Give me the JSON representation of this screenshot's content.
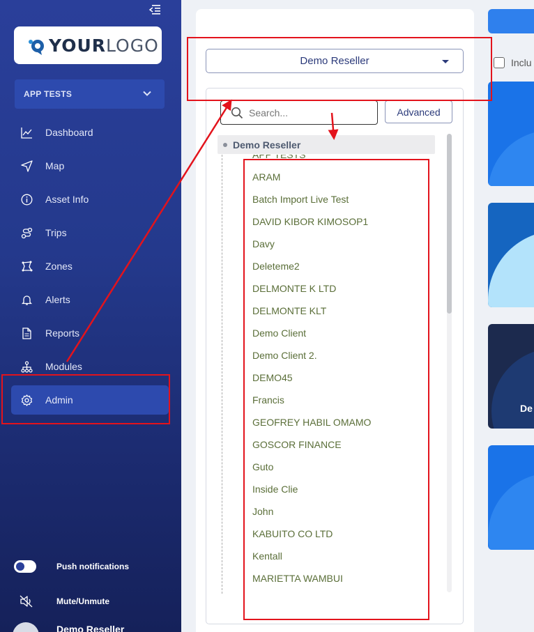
{
  "sidebar": {
    "logo_text_a": "YOUR",
    "logo_text_b": "LOGO",
    "app_selector": "APP TESTS",
    "nav": [
      {
        "label": "Dashboard",
        "icon": "chart-line-icon"
      },
      {
        "label": "Map",
        "icon": "navigation-arrow-icon"
      },
      {
        "label": "Asset Info",
        "icon": "info-circle-icon"
      },
      {
        "label": "Trips",
        "icon": "route-icon"
      },
      {
        "label": "Zones",
        "icon": "polygon-icon"
      },
      {
        "label": "Alerts",
        "icon": "bell-icon"
      },
      {
        "label": "Reports",
        "icon": "file-icon"
      },
      {
        "label": "Modules",
        "icon": "hierarchy-icon"
      },
      {
        "label": "Admin",
        "icon": "gear-icon",
        "active": true
      }
    ],
    "push_notifications": "Push notifications",
    "mute_unmute": "Mute/Unmute",
    "user_name": "Demo Reseller"
  },
  "main": {
    "reseller_dropdown": "Demo Reseller",
    "search_placeholder": "Search...",
    "advanced_button": "Advanced",
    "tree_root": "Demo Reseller",
    "tree_items": [
      "APP TESTS",
      "ARAM",
      "Batch Import Live Test",
      "DAVID KIBOR KIMOSOP1",
      "Davy",
      "Deleteme2",
      "DELMONTE K LTD",
      "DELMONTE KLT",
      "Demo Client",
      "Demo Client 2.",
      "DEMO45",
      "Francis",
      "GEOFREY HABIL OMAMO",
      "GOSCOR FINANCE",
      "Guto",
      "Inside Clie",
      "John",
      "KABUITO CO LTD",
      "Kentall",
      "MARIETTA WAMBUI"
    ]
  },
  "right": {
    "include_label": "Inclu",
    "card_label": "De"
  },
  "colors": {
    "sidebar_top": "#2a3f9a",
    "sidebar_bottom": "#15215a",
    "accent": "#2d4aae",
    "annotation": "#e3131c",
    "tree_text": "#5a6e38"
  }
}
